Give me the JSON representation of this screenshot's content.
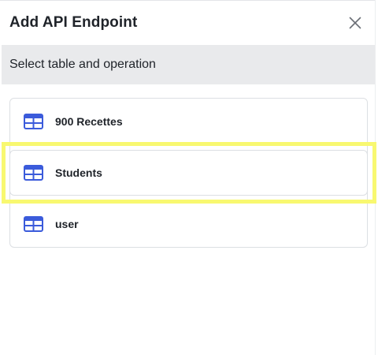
{
  "dialog": {
    "title": "Add API Endpoint",
    "close_icon": "close-icon",
    "subtitle": "Select table and operation"
  },
  "tables": [
    {
      "label": "900 Recettes",
      "icon": "table-icon"
    },
    {
      "label": "Students",
      "icon": "table-icon",
      "highlighted": true
    },
    {
      "label": "user",
      "icon": "table-icon"
    }
  ],
  "colors": {
    "icon_blue": "#3b5bdb",
    "highlight": "#f8f870",
    "subheader_bg": "#e9eaec"
  }
}
